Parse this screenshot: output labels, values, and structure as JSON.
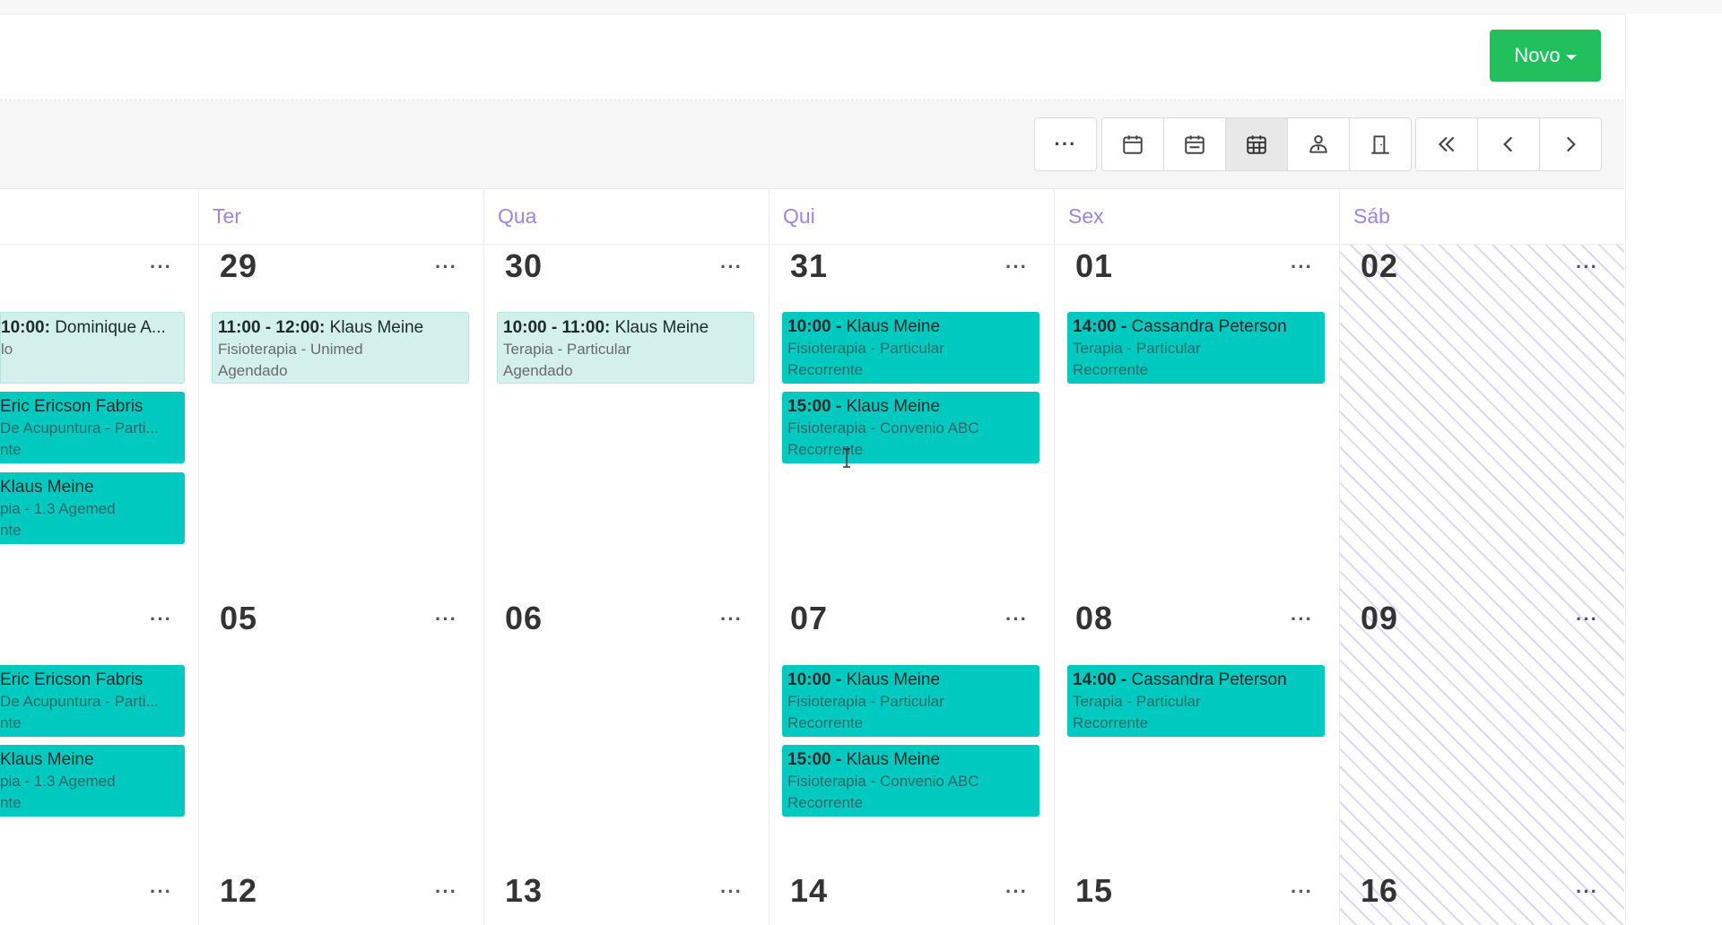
{
  "header": {
    "new_button_label": "Novo"
  },
  "toolbar": {
    "more_label": "···",
    "icons": [
      "calendar-day-icon",
      "calendar-week-icon",
      "calendar-month-icon",
      "professional-icon",
      "room-icon",
      "double-chevron-left-icon",
      "chevron-left-icon",
      "chevron-right-icon"
    ]
  },
  "days": [
    "Ter",
    "Qua",
    "Qui",
    "Sex",
    "Sáb"
  ],
  "more_label": "···",
  "weeks": [
    {
      "numbers": [
        "29",
        "30",
        "31",
        "01",
        "02"
      ]
    },
    {
      "numbers": [
        "05",
        "06",
        "07",
        "08",
        "09"
      ]
    },
    {
      "numbers": [
        "12",
        "13",
        "14",
        "15",
        "16"
      ]
    }
  ],
  "events": {
    "w1_mon_1": {
      "time": "10:00:",
      "name": "Dominique A...",
      "sub1": "lo",
      "sub2": ""
    },
    "w1_mon_2": {
      "time": "",
      "name": "Eric Ericson Fabris",
      "sub1": "De Acupuntura - Parti...",
      "sub2": "nte"
    },
    "w1_mon_3": {
      "time": "",
      "name": "Klaus Meine",
      "sub1": "pia - 1.3 Agemed",
      "sub2": "nte"
    },
    "w1_tue_1": {
      "time": "11:00 - 12:00:",
      "name": "Klaus Meine",
      "sub1": "Fisioterapia - Unimed",
      "sub2": "Agendado"
    },
    "w1_wed_1": {
      "time": "10:00 - 11:00:",
      "name": "Klaus Meine",
      "sub1": "Terapia - Particular",
      "sub2": "Agendado"
    },
    "w1_thu_1": {
      "time": "10:00 -",
      "name": "Klaus Meine",
      "sub1": "Fisioterapia - Particular",
      "sub2": "Recorrente"
    },
    "w1_thu_2": {
      "time": "15:00 -",
      "name": "Klaus Meine",
      "sub1": "Fisioterapia - Convenio ABC",
      "sub2": "Recorrente"
    },
    "w1_fri_1": {
      "time": "14:00 -",
      "name": "Cassandra Peterson",
      "sub1": "Terapia - Particular",
      "sub2": "Recorrente"
    },
    "w2_mon_1": {
      "time": "",
      "name": "Eric Ericson Fabris",
      "sub1": "De Acupuntura - Parti...",
      "sub2": "nte"
    },
    "w2_mon_2": {
      "time": "",
      "name": "Klaus Meine",
      "sub1": "pia - 1.3 Agemed",
      "sub2": "nte"
    },
    "w2_thu_1": {
      "time": "10:00 -",
      "name": "Klaus Meine",
      "sub1": "Fisioterapia - Particular",
      "sub2": "Recorrente"
    },
    "w2_thu_2": {
      "time": "15:00 -",
      "name": "Klaus Meine",
      "sub1": "Fisioterapia - Convenio ABC",
      "sub2": "Recorrente"
    },
    "w2_fri_1": {
      "time": "14:00 -",
      "name": "Cassandra Peterson",
      "sub1": "Terapia - Particular",
      "sub2": "Recorrente"
    }
  },
  "colors": {
    "accent_green": "#21c05d",
    "recurring_event": "#00c9c0",
    "scheduled_event": "#d3f0ec",
    "day_header": "#9a86e6"
  }
}
